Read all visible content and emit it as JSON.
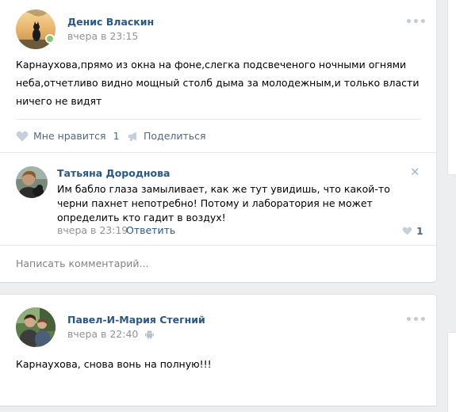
{
  "posts": [
    {
      "author": "Денис Власкин",
      "date": "вчера в 23:15",
      "text": "Карнаухова,прямо из окна на фоне,слегка подсвеченого ночными огнями неба,отчетливо видно мощный столб дыма за молодежным,и только власти ничего не видят",
      "like_label": "Мне нравится",
      "like_count": "1",
      "share_label": "Поделиться",
      "comment": {
        "author": "Татьяна Дороднова",
        "text": "Им бабло глаза замыливает, как же тут увидишь, что какой-то черни пахнет непотребно! Потому и лаборатория не может определить кто гадит в воздух!",
        "date": "вчера в 23:19",
        "reply_label": "Ответить",
        "like_count": "1",
        "close_glyph": "✕"
      },
      "write_comment_placeholder": "Написать комментарий..."
    },
    {
      "author": "Павел-И-Мария Стегний",
      "date": "вчера в 22:40",
      "text": "Карнаухова, снова вонь на полную!!!"
    }
  ],
  "menu_glyph": "•••",
  "colors": {
    "link": "#2a5885",
    "muted": "#939393",
    "online": "#8ac176",
    "background": "#edeef0"
  },
  "icons": [
    "heart-icon",
    "megaphone-icon",
    "close-icon",
    "android-icon",
    "menu-dots-icon"
  ]
}
